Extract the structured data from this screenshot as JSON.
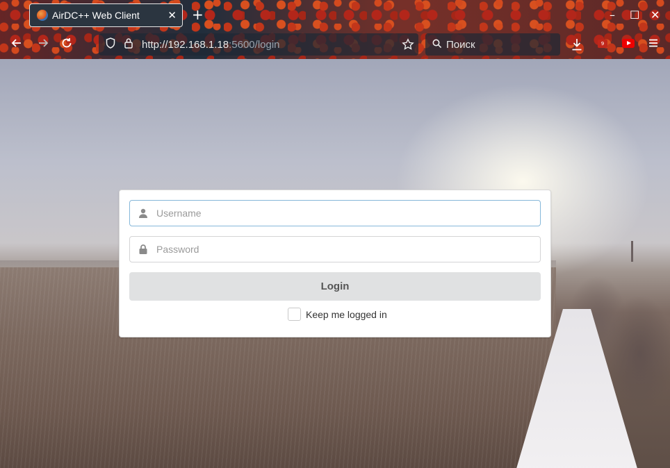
{
  "browser": {
    "tab_title": "AirDC++ Web Client",
    "tab_close": "✕",
    "new_tab": "+",
    "url_host": "http://192.168.1.18",
    "url_rest": ":5600/login",
    "search_placeholder": "Поиск",
    "extension_badge": "9",
    "window_controls": {
      "minimize": "–",
      "maximize": "☐",
      "close": "✕"
    },
    "icons": [
      "back-icon",
      "forward-icon",
      "reload-icon",
      "shield-icon",
      "lock-icon",
      "star-icon",
      "search-icon",
      "download-icon",
      "youtube-icon",
      "menu-icon"
    ]
  },
  "login": {
    "username_placeholder": "Username",
    "password_placeholder": "Password",
    "login_label": "Login",
    "remember_label": "Keep me logged in"
  },
  "colors": {
    "focus_border": "#85b7d9",
    "button_bg": "#e0e1e2",
    "button_text": "#555555"
  }
}
